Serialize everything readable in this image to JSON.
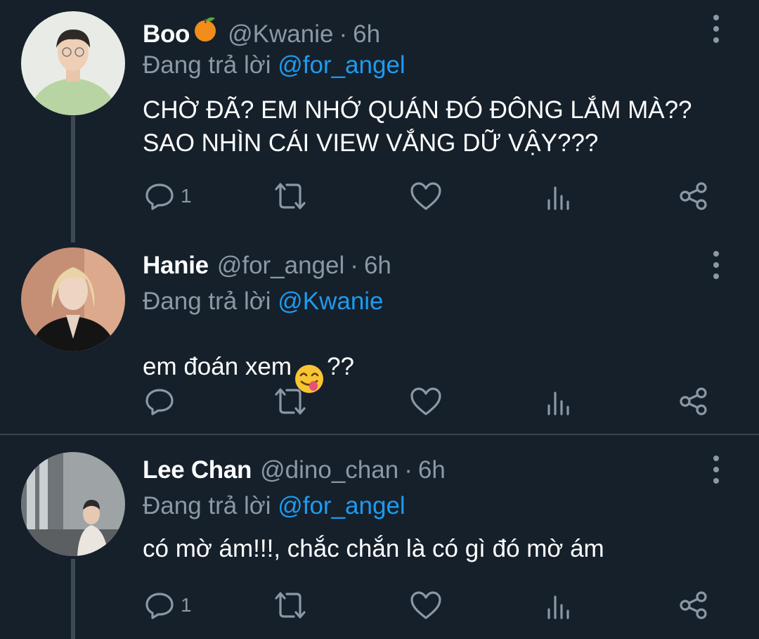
{
  "tweets": [
    {
      "name": "Boo",
      "name_emoji": "tangerine-emoji",
      "handle": "@Kwanie",
      "sep": "·",
      "time": "6h",
      "reply_prefix": "Đang trả lời",
      "reply_mention": "@for_angel",
      "text": "CHỜ ĐÃ? EM NHỚ QUÁN ĐÓ ĐÔNG LẮM MÀ??\nSAO NHÌN CÁI VIEW VẮNG DỮ VẬY???",
      "reply_count": "1"
    },
    {
      "name": "Hanie",
      "handle": "@for_angel",
      "sep": "·",
      "time": "6h",
      "reply_prefix": "Đang trả lời",
      "reply_mention": "@Kwanie",
      "text_before": "em đoán xem",
      "text_emoji": "savoring-food-emoji",
      "text_after": "??",
      "reply_count": ""
    },
    {
      "name": "Lee Chan",
      "handle": "@dino_chan",
      "sep": "·",
      "time": "6h",
      "reply_prefix": "Đang trả lời",
      "reply_mention": "@for_angel",
      "text": "có mờ ám!!!, chắc chắn là có gì đó mờ ám",
      "reply_count": "1"
    }
  ],
  "icons": [
    "reply-icon",
    "retweet-icon",
    "like-icon",
    "analytics-icon",
    "share-icon",
    "more-options-icon"
  ],
  "colors": {
    "background": "#15202b",
    "muted": "#8b98a5",
    "mention": "#1d9bf0",
    "divider": "#38444d"
  }
}
